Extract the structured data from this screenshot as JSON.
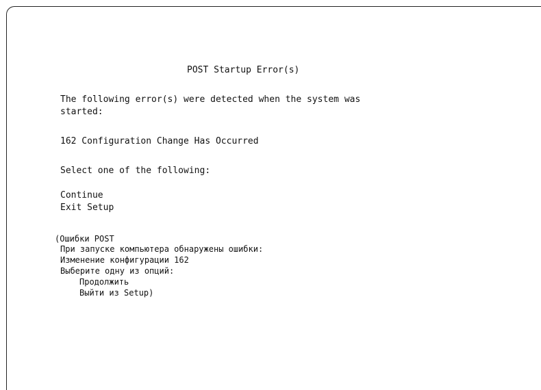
{
  "screen": {
    "title": "POST Startup Error(s)",
    "message_line1": "The following error(s) were detected when the system was",
    "message_line2": "started:",
    "error_line": "162 Configuration Change Has Occurred",
    "prompt": "Select one of the following:",
    "options": [
      "Continue",
      "Exit Setup"
    ]
  },
  "translation": {
    "heading": "(Ошибки POST",
    "line_detected": "При запуске компьютера обнаружены ошибки:",
    "line_error": "Изменение конфигурации 162",
    "line_prompt": "Выберите одну из опций:",
    "option_continue": "Продолжить",
    "option_exit": "Выйти из Setup)"
  }
}
